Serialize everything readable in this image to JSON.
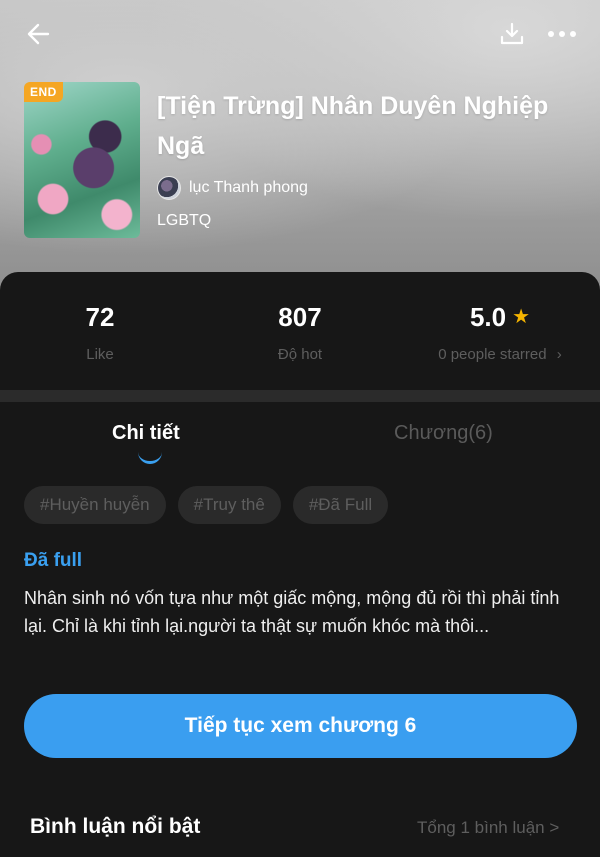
{
  "header": {
    "back_icon": "arrow-left-icon",
    "download_icon": "download-icon",
    "more_icon": "more-horizontal-icon"
  },
  "book": {
    "badge": "END",
    "title": "[Tiện Trừng] Nhân Duyên Nghiệp Ngã",
    "author": "lục Thanh phong",
    "genre": "LGBTQ"
  },
  "stats": {
    "like_value": "72",
    "like_label": "Like",
    "hot_value": "807",
    "hot_label": "Độ hot",
    "rating_value": "5.0",
    "rating_label": "0 people starred",
    "rating_chevron": "›"
  },
  "tabs": {
    "detail": "Chi tiết",
    "chapters": "Chương(6)"
  },
  "tags": [
    "#Huyền huyễn",
    "#Truy thê",
    "#Đã Full"
  ],
  "status": "Đã full",
  "synopsis": "Nhân sinh nó vốn  tựa như một giấc mộng, mộng đủ rồi thì phải tỉnh lại. Chỉ là khi tỉnh lại.người ta thật sự muốn khóc mà thôi...",
  "cta_label": "Tiếp tục xem chương 6",
  "comments": {
    "title": "Bình luận nổi bật",
    "total": "Tổng 1 bình luận >"
  },
  "colors": {
    "accent": "#3a9ef0",
    "badge": "#f5a623",
    "star": "#f5b400",
    "panel": "#171717"
  }
}
